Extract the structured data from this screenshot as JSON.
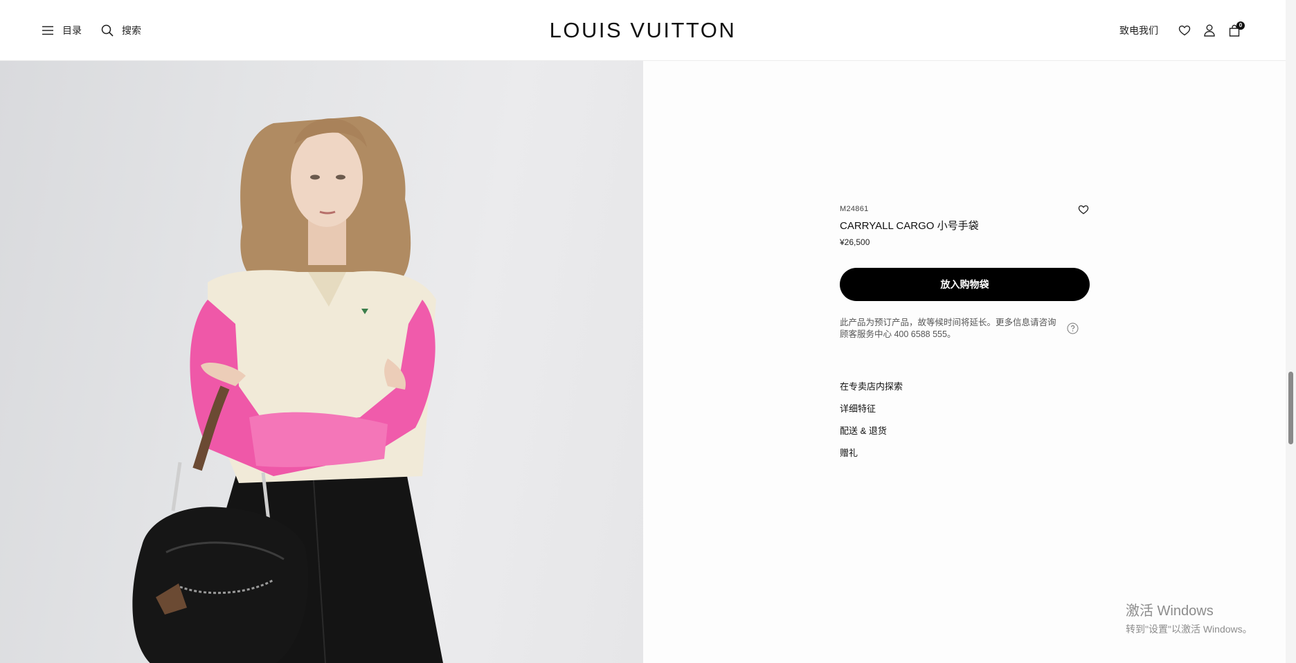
{
  "header": {
    "menu_label": "目录",
    "search_label": "搜索",
    "logo": "LOUIS VUITTON",
    "contact_label": "致电我们",
    "cart_count": "0"
  },
  "product": {
    "sku": "M24861",
    "title": "CARRYALL CARGO 小号手袋",
    "price": "¥26,500",
    "add_to_bag": "放入购物袋",
    "notice": "此产品为预订产品，故等候时间将延长。更多信息请咨询顾客服务中心 400 6588 555。",
    "links": [
      "在专卖店内探索",
      "详细特征",
      "配送 & 退货",
      "赠礼"
    ]
  },
  "watermark": {
    "line1": "激活 Windows",
    "line2": "转到\"设置\"以激活 Windows。"
  },
  "colors": {
    "sweater_pink": "#f05bab",
    "sweater_cream": "#f1ead8",
    "skirt_black": "#141414",
    "button_black": "#000000"
  }
}
